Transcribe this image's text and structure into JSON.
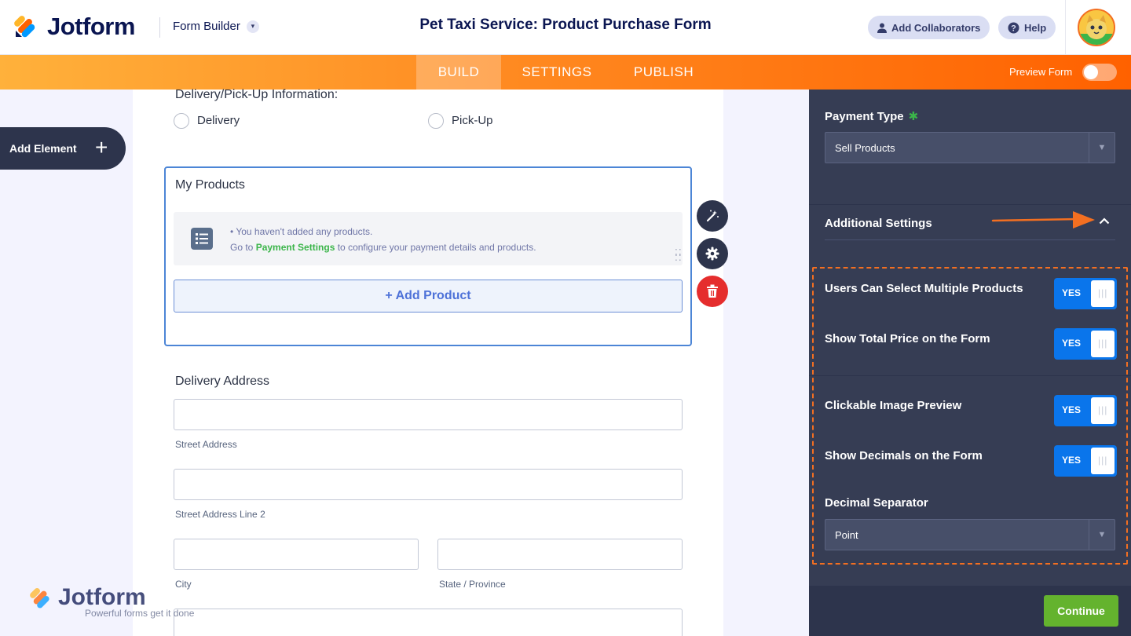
{
  "header": {
    "logo_text": "Jotform",
    "builder_label": "Form Builder",
    "form_title": "Pet Taxi Service: Product Purchase Form",
    "collaborators_label": "Add Collaborators",
    "help_label": "Help"
  },
  "nav": {
    "tabs": [
      {
        "label": "BUILD",
        "active": true
      },
      {
        "label": "SETTINGS",
        "active": false
      },
      {
        "label": "PUBLISH",
        "active": false
      }
    ],
    "preview_label": "Preview Form"
  },
  "sidebar": {
    "add_element_label": "Add Element"
  },
  "form": {
    "delivery_question": "Delivery/Pick-Up Information:",
    "delivery_options": [
      "Delivery",
      "Pick-Up"
    ],
    "products_title": "My Products",
    "notice_line1": "You haven't added any products.",
    "notice_line2_prefix": "Go to ",
    "notice_link": "Payment Settings",
    "notice_line2_suffix": " to configure your payment details and products.",
    "add_product_label": "+ Add Product",
    "address_title": "Delivery Address",
    "street_label": "Street Address",
    "street2_label": "Street Address Line 2",
    "city_label": "City",
    "state_label": "State / Province"
  },
  "watermark": {
    "title": "Jotform",
    "tagline": "Powerful forms get it done"
  },
  "panel": {
    "payment_type_label": "Payment Type",
    "payment_type_value": "Sell Products",
    "additional_settings_label": "Additional Settings",
    "settings": [
      {
        "label": "Users Can Select Multiple Products",
        "value": "YES"
      },
      {
        "label": "Show Total Price on the Form",
        "value": "YES"
      },
      {
        "label": "Clickable Image Preview",
        "value": "YES"
      },
      {
        "label": "Show Decimals on the Form",
        "value": "YES"
      }
    ],
    "decimal_separator_label": "Decimal Separator",
    "decimal_separator_value": "Point",
    "continue_label": "Continue"
  },
  "colors": {
    "accent_orange": "#ff6100",
    "toggle_blue": "#0a75eb",
    "continue_green": "#64b32e",
    "panel_bg": "#363d54"
  }
}
